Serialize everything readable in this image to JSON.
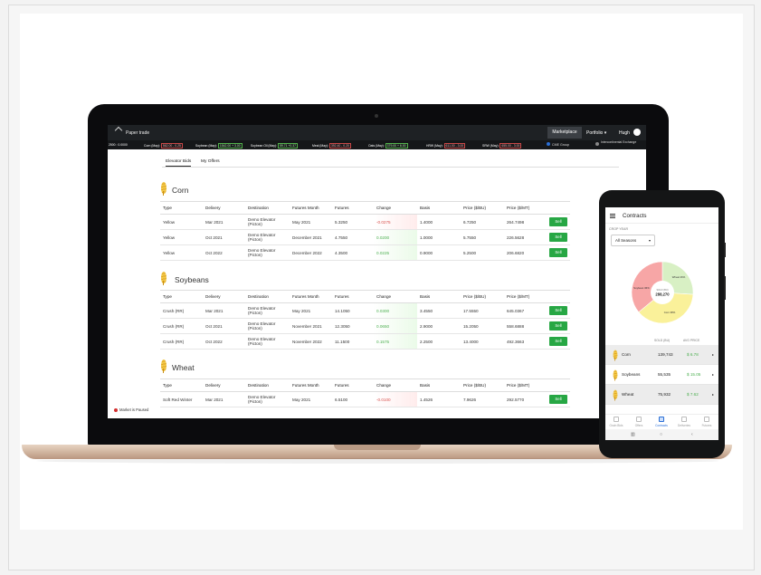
{
  "app": {
    "brand": "Paper trade",
    "nav": {
      "marketplace": "Marketplace",
      "portfolio": "Portfolio ▾",
      "user": "Hugh"
    }
  },
  "ticker": [
    {
      "label": "2500  : 0.0000",
      "badge": "",
      "dir": "down"
    },
    {
      "label": "Corn (May):",
      "badge": "562.00 - 0.25",
      "dir": "down"
    },
    {
      "label": "Soybean (May):",
      "badge": "1542.00 + 3.00",
      "dir": "up"
    },
    {
      "label": "Soybean Oil (May):",
      "badge": "59.71 +0.37",
      "dir": "up"
    },
    {
      "label": "Meal (May):",
      "badge": "392.40 - 0.20",
      "dir": "down"
    },
    {
      "label": "Oats (May):",
      "badge": "379.00 + 6.00",
      "dir": "up"
    },
    {
      "label": "HRW (May):",
      "badge": "611.00 - 3.00",
      "dir": "down"
    },
    {
      "label": "SRW (May):",
      "badge": "655.00 - 3.00",
      "dir": "down"
    }
  ],
  "exchanges": {
    "cme": "CME Group",
    "ice": "Intercontinental Exchange"
  },
  "tabs": {
    "elevator_bids": "Elevator Bids",
    "my_offers": "My Offers"
  },
  "columns": [
    "Type",
    "Delivery",
    "Destination",
    "Futures Month",
    "Futures",
    "Change",
    "Basis",
    "Price ($/BU)",
    "Price ($/MT)",
    ""
  ],
  "sell_label": "Sell",
  "sections": [
    {
      "title": "Corn",
      "rows": [
        {
          "type": "Yellow",
          "delivery": "Mar 2021",
          "destination": "Demo Elevator (Picton)",
          "futures_month": "May 2021",
          "futures": "5.3250",
          "change": "-0.0275",
          "basis": "1.4000",
          "price_bu": "6.7250",
          "price_mt": "264.7498"
        },
        {
          "type": "Yellow",
          "delivery": "Oct 2021",
          "destination": "Demo Elevator (Picton)",
          "futures_month": "December 2021",
          "futures": "4.7550",
          "change": "0.0200",
          "basis": "1.0000",
          "price_bu": "5.7550",
          "price_mt": "226.5628"
        },
        {
          "type": "Yellow",
          "delivery": "Oct 2022",
          "destination": "Demo Elevator (Picton)",
          "futures_month": "December 2022",
          "futures": "4.3500",
          "change": "0.0225",
          "basis": "0.9000",
          "price_bu": "5.2500",
          "price_mt": "206.6820"
        }
      ]
    },
    {
      "title": "Soybeans",
      "rows": [
        {
          "type": "Crush (RR)",
          "delivery": "Mar 2021",
          "destination": "Demo Elevator (Picton)",
          "futures_month": "May 2021",
          "futures": "14.1050",
          "change": "0.0300",
          "basis": "3.4550",
          "price_bu": "17.5550",
          "price_mt": "645.0367"
        },
        {
          "type": "Crush (RR)",
          "delivery": "Oct 2021",
          "destination": "Demo Elevator (Picton)",
          "futures_month": "November 2021",
          "futures": "12.3050",
          "change": "0.0650",
          "basis": "2.9000",
          "price_bu": "15.2050",
          "price_mt": "558.6888"
        },
        {
          "type": "Crush (RR)",
          "delivery": "Oct 2022",
          "destination": "Demo Elevator (Picton)",
          "futures_month": "November 2022",
          "futures": "11.1500",
          "change": "0.1575",
          "basis": "2.2500",
          "price_bu": "13.4000",
          "price_mt": "492.3663"
        }
      ]
    },
    {
      "title": "Wheat",
      "rows": [
        {
          "type": "Soft Red Winter",
          "delivery": "Mar 2021",
          "destination": "Demo Elevator (Picton)",
          "futures_month": "May 2021",
          "futures": "6.5100",
          "change": "-0.0100",
          "basis": "1.4526",
          "price_bu": "7.9626",
          "price_mt": "292.5770"
        }
      ]
    }
  ],
  "status": {
    "market_paused": "Market is Paused"
  },
  "phone": {
    "title": "Contracts",
    "crop_year_label": "CROP YEAR",
    "season_value": "All Seasons",
    "donut": {
      "center_label": "SOLD (BU)",
      "center_value": "288,270",
      "slices": [
        {
          "name": "Wheat",
          "label": "Wheat 26%",
          "percent": 26,
          "color": "#d8f0c4"
        },
        {
          "name": "Corn",
          "label": "Corn 38%",
          "percent": 38,
          "color": "#faf19a"
        },
        {
          "name": "Soybean",
          "label": "Soybean 36%",
          "percent": 36,
          "color": "#f7a6a6"
        }
      ]
    },
    "cols": {
      "sold": "SOLD (BU)",
      "apr": "AVG PRICE"
    },
    "rows": [
      {
        "name": "Corn",
        "sold": "139,743",
        "apr": "$ 6.78"
      },
      {
        "name": "Soybeans",
        "sold": "55,535",
        "apr": "$ 15.05"
      },
      {
        "name": "Wheat",
        "sold": "75,932",
        "apr": "$ 7.62"
      }
    ],
    "bottom_nav": [
      "Grain Bids",
      "Offers",
      "Contracts",
      "Deliveries",
      "Futures"
    ]
  }
}
